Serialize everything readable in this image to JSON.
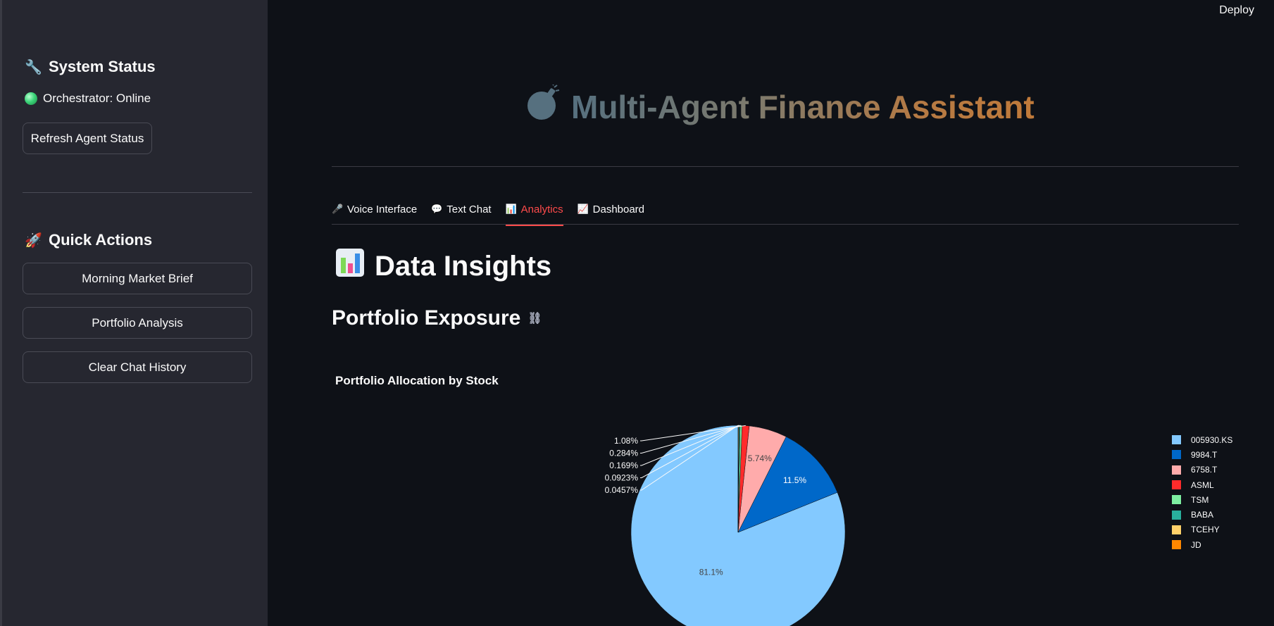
{
  "app": {
    "deploy_label": "Deploy"
  },
  "sidebar": {
    "system_status": {
      "heading": "System Status",
      "icon": "wrench-icon",
      "orchestrator_status": "Orchestrator: Online",
      "refresh_button": "Refresh Agent Status"
    },
    "quick_actions": {
      "heading": "Quick Actions",
      "icon": "rocket-icon",
      "buttons": [
        "Morning Market Brief",
        "Portfolio Analysis",
        "Clear Chat History"
      ]
    }
  },
  "main": {
    "title": "Multi-Agent Finance Assistant",
    "title_icon": "bomb-icon",
    "tabs": [
      {
        "label": "Voice Interface",
        "icon": "microphone-icon",
        "active": false
      },
      {
        "label": "Text Chat",
        "icon": "speech-bubble-icon",
        "active": false
      },
      {
        "label": "Analytics",
        "icon": "bar-chart-icon",
        "active": true
      },
      {
        "label": "Dashboard",
        "icon": "line-chart-icon",
        "active": false
      }
    ],
    "section_title": "Data Insights",
    "subsection_title": "Portfolio Exposure"
  },
  "colors": {
    "background": "#0e1117",
    "sidebar": "#262730",
    "accent": "#ff4b4b"
  },
  "chart_data": {
    "type": "pie",
    "title": "Portfolio Allocation by Stock",
    "legend_position": "right",
    "slices": [
      {
        "label": "005930.KS",
        "value": 81.1,
        "text": "81.1%",
        "color": "#83c9ff"
      },
      {
        "label": "9984.T",
        "value": 11.5,
        "text": "11.5%",
        "color": "#0068c9"
      },
      {
        "label": "6758.T",
        "value": 5.74,
        "text": "5.74%",
        "color": "#ffabab"
      },
      {
        "label": "ASML",
        "value": 1.08,
        "text": "1.08%",
        "color": "#ff2b2b"
      },
      {
        "label": "TSM",
        "value": 0.284,
        "text": "0.284%",
        "color": "#7defa1"
      },
      {
        "label": "BABA",
        "value": 0.169,
        "text": "0.169%",
        "color": "#29b09d"
      },
      {
        "label": "TCEHY",
        "value": 0.0923,
        "text": "0.0923%",
        "color": "#ffd16a"
      },
      {
        "label": "JD",
        "value": 0.0457,
        "text": "0.0457%",
        "color": "#ff8700"
      }
    ]
  }
}
